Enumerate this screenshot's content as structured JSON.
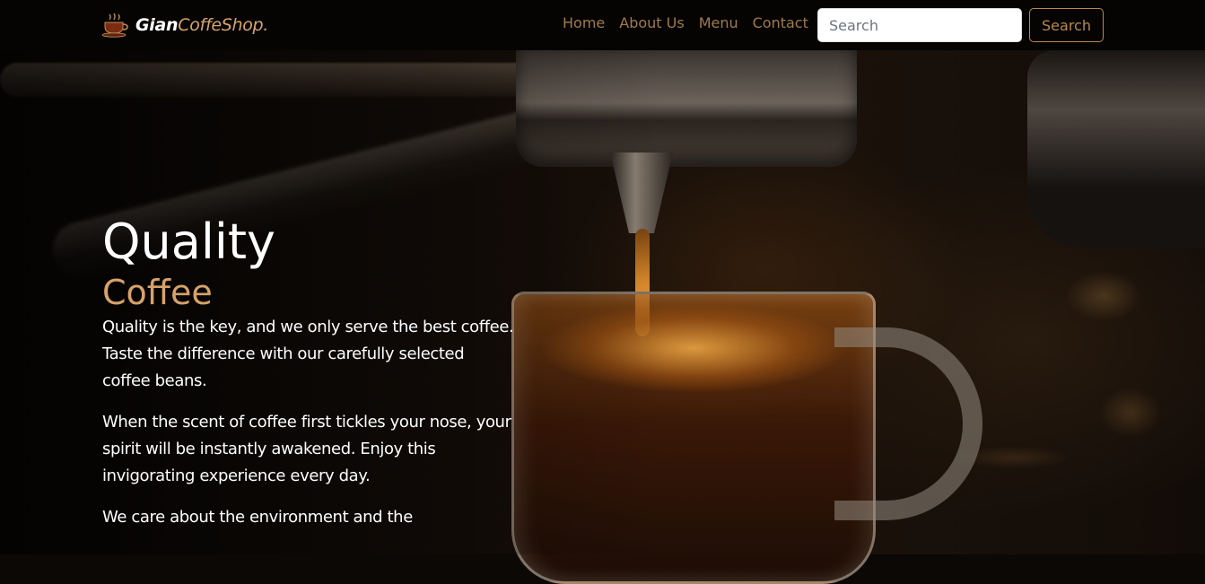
{
  "navbar": {
    "brand": {
      "part1": "Gian",
      "part2": "CoffeShop."
    },
    "links": [
      "Home",
      "About Us",
      "Menu",
      "Contact"
    ],
    "search": {
      "placeholder": "Search",
      "button_label": "Search"
    }
  },
  "hero": {
    "title": "Quality",
    "subtitle": "Coffee",
    "paragraphs": [
      "Quality is the key, and we only serve the best coffee. Taste the difference with our carefully selected coffee beans.",
      "When the scent of coffee first tickles your nose, your spirit will be instantly awakened. Enjoy this invigorating experience every day.",
      "We care about the environment and the"
    ]
  },
  "colors": {
    "accent": "#d7a26a",
    "nav_link": "#a07a4c",
    "navbar_bg": "#050403"
  },
  "icons": {
    "brand": "coffee-cup-icon"
  }
}
